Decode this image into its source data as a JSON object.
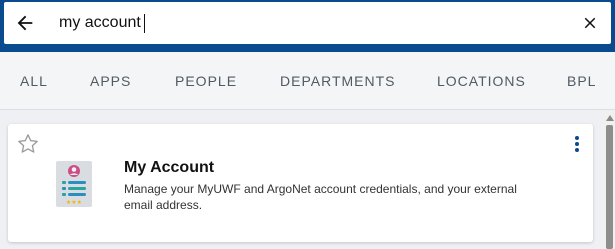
{
  "search": {
    "value": "my account",
    "back_icon": "arrow-left-icon",
    "clear_icon": "close-icon"
  },
  "tabs": [
    {
      "label": "ALL"
    },
    {
      "label": "APPS"
    },
    {
      "label": "PEOPLE"
    },
    {
      "label": "DEPARTMENTS"
    },
    {
      "label": "LOCATIONS"
    },
    {
      "label": "BPL"
    }
  ],
  "results": [
    {
      "title": "My Account",
      "description": "Manage your MyUWF and ArgoNet account credentials, and your external email address.",
      "icon": "account-card-icon",
      "favorite_icon": "star-outline-icon",
      "menu_icon": "more-vertical-icon"
    }
  ],
  "colors": {
    "header": "#0a4a8f",
    "accent": "#0a4a8f"
  }
}
